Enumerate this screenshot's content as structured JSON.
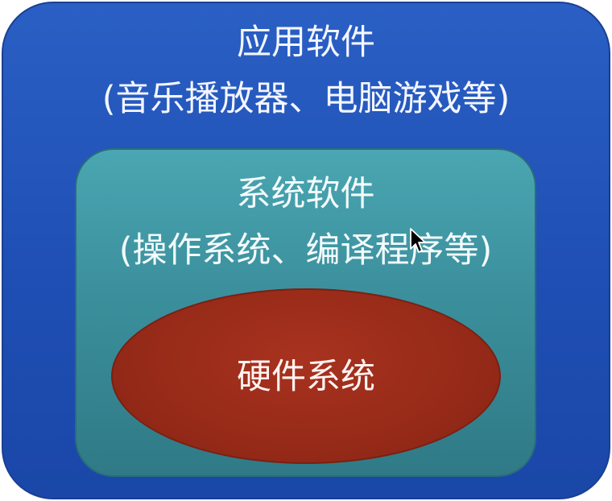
{
  "layers": {
    "application": {
      "title": "应用软件",
      "subtitle": "(音乐播放器、电脑游戏等)",
      "color": "#2257bd"
    },
    "system": {
      "title": "系统软件",
      "subtitle": "(操作系统、编译程序等)",
      "color": "#3b8f9c"
    },
    "hardware": {
      "title": "硬件系统",
      "color": "#962a18"
    }
  },
  "icons": {
    "cursor": "mouse-pointer-icon"
  }
}
